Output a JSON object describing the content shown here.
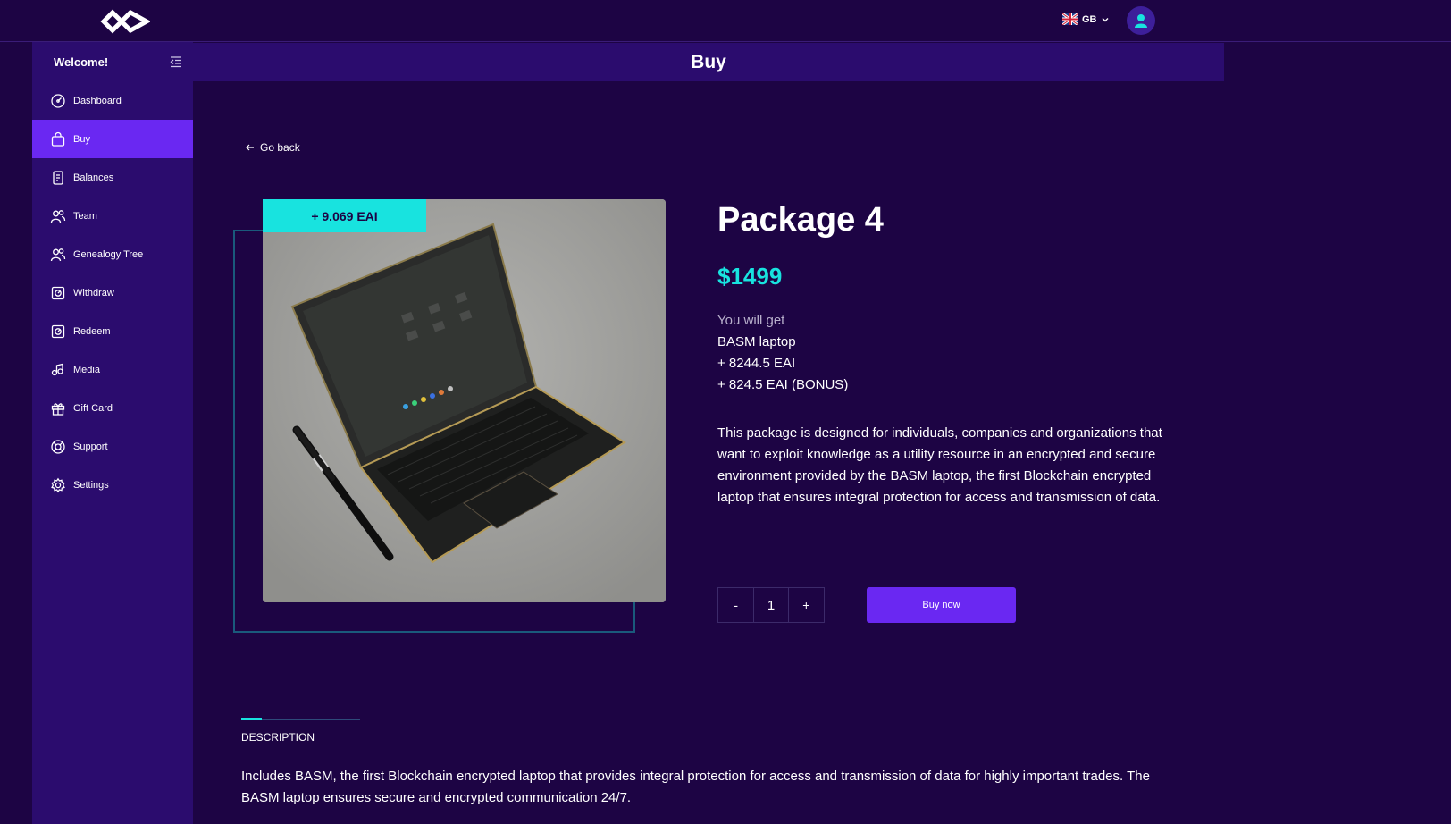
{
  "header": {
    "lang_code": "GB",
    "title": "Buy"
  },
  "sidebar": {
    "welcome": "Welcome!",
    "items": [
      {
        "label": "Dashboard",
        "icon": "dashboard-icon"
      },
      {
        "label": "Buy",
        "icon": "shopping-bag-icon",
        "active": true
      },
      {
        "label": "Balances",
        "icon": "receipt-icon"
      },
      {
        "label": "Team",
        "icon": "team-icon"
      },
      {
        "label": "Genealogy Tree",
        "icon": "genealogy-icon"
      },
      {
        "label": "Withdraw",
        "icon": "withdraw-icon"
      },
      {
        "label": "Redeem",
        "icon": "redeem-icon"
      },
      {
        "label": "Media",
        "icon": "media-icon"
      },
      {
        "label": "Gift Card",
        "icon": "gift-icon"
      },
      {
        "label": "Support",
        "icon": "support-icon"
      },
      {
        "label": "Settings",
        "icon": "gear-icon"
      }
    ]
  },
  "main": {
    "go_back": "Go back",
    "bonus_tag": "+ 9.069 EAI",
    "package_title": "Package 4",
    "price": "$1499",
    "you_will_get_label": "You will get",
    "get_items": [
      "BASM laptop",
      "+ 8244.5 EAI",
      "+ 824.5 EAI (BONUS)"
    ],
    "description": "This package is designed for individuals, companies and organizations that want to exploit knowledge as a utility resource in an encrypted and secure environment provided by the BASM laptop, the first Blockchain encrypted laptop that ensures integral protection for access and transmission of data.",
    "quantity": {
      "minus": "-",
      "value": "1",
      "plus": "+"
    },
    "buy_button": "Buy now",
    "tab_label": "DESCRIPTION",
    "tab_progress": 0.17,
    "tab_text": "Includes BASM, the first Blockchain encrypted laptop that provides integral protection for access and transmission of data for highly important trades. The BASM laptop ensures secure and encrypted communication 24/7."
  },
  "colors": {
    "background": "#1d0444",
    "sidebar": "#2b0c6e",
    "accent_purple": "#6a28f2",
    "accent_cyan": "#18e3df"
  }
}
